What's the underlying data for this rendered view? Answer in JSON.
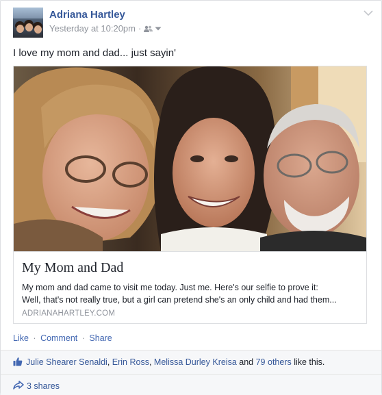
{
  "post": {
    "author_name": "Adriana Hartley",
    "timestamp": "Yesterday at 10:20pm",
    "separator": "·",
    "audience_icon": "friends-icon",
    "menu_icon": "chevron-down-icon",
    "text": "I love my mom and dad... just sayin'"
  },
  "attachment": {
    "title": "My Mom and Dad",
    "description_line1": "My mom and dad came to visit me today.  Just me.  Here's our selfie to prove it:",
    "description_line2": "Well, that's not really true, but a girl can pretend she's an only child and had them...",
    "domain": "ADRIANAHARTLEY.COM"
  },
  "actions": {
    "like": "Like",
    "comment": "Comment",
    "share": "Share",
    "separator": "·"
  },
  "likes": {
    "icon": "thumbs-up-icon",
    "person1": "Julie Shearer Senaldi",
    "comma1": ", ",
    "person2": "Erin Ross",
    "comma2": ", ",
    "person3": "Melissa Durley Kreisa",
    "and_text": " and ",
    "others": "79 others",
    "suffix": " like this."
  },
  "shares": {
    "icon": "share-arrow-icon",
    "count_text": "3 shares"
  },
  "colors": {
    "link_blue": "#365899",
    "action_blue": "#4267b2",
    "meta_gray": "#90949c",
    "footer_bg": "#f6f7f9"
  }
}
